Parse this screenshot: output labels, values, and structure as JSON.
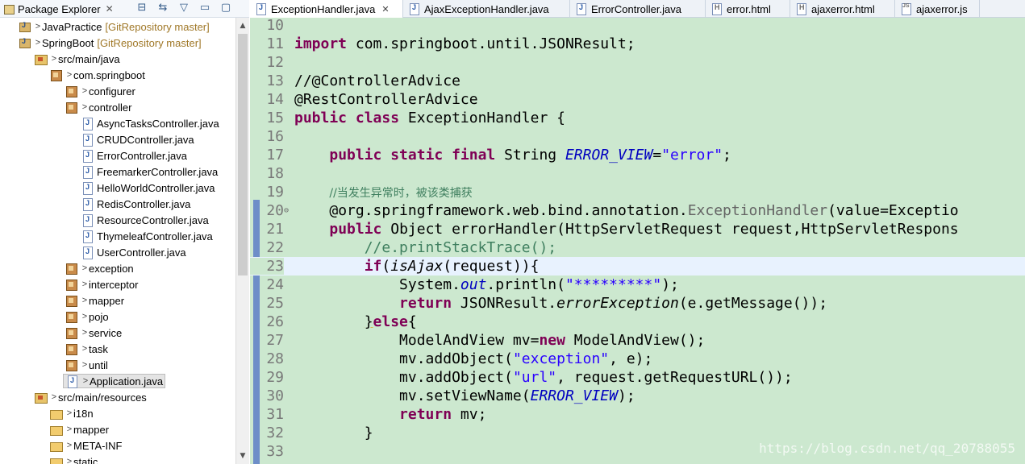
{
  "package_explorer": {
    "title": "Package Explorer",
    "close": "✕",
    "tools": {
      "collapse": "⊟",
      "link": "⇆",
      "menu": "▽",
      "minimize": "▭",
      "maximize": "▢"
    },
    "tree": [
      {
        "name": "JavaPractice",
        "git": "[GitRepository master]"
      },
      {
        "name": "SpringBoot",
        "git": "[GitRepository master]"
      },
      {
        "name": "src/main/java"
      },
      {
        "name": "com.springboot"
      },
      {
        "name": "configurer"
      },
      {
        "name": "controller"
      },
      {
        "name": "AsyncTasksController.java"
      },
      {
        "name": "CRUDController.java"
      },
      {
        "name": "ErrorController.java"
      },
      {
        "name": "FreemarkerController.java"
      },
      {
        "name": "HelloWorldController.java"
      },
      {
        "name": "RedisController.java"
      },
      {
        "name": "ResourceController.java"
      },
      {
        "name": "ThymeleafController.java"
      },
      {
        "name": "UserController.java"
      },
      {
        "name": "exception"
      },
      {
        "name": "interceptor"
      },
      {
        "name": "mapper"
      },
      {
        "name": "pojo"
      },
      {
        "name": "service"
      },
      {
        "name": "task"
      },
      {
        "name": "until"
      },
      {
        "name": "Application.java"
      },
      {
        "name": "src/main/resources"
      },
      {
        "name": "i18n"
      },
      {
        "name": "mapper"
      },
      {
        "name": "META-INF"
      },
      {
        "name": "static"
      }
    ],
    "arrow_collapsed": ">",
    "scroll_up": "▲",
    "scroll_down": "▼"
  },
  "editor": {
    "tabs": [
      {
        "label": "ExceptionHandler.java",
        "close": "✕"
      },
      {
        "label": "AjaxExceptionHandler.java"
      },
      {
        "label": "ErrorController.java"
      },
      {
        "label": "error.html"
      },
      {
        "label": "ajaxerror.html"
      },
      {
        "label": "ajaxerror.js"
      }
    ],
    "line_numbers": [
      "10",
      "11",
      "12",
      "13",
      "14",
      "15",
      "16",
      "17",
      "18",
      "19",
      "20",
      "21",
      "22",
      "23",
      "24",
      "25",
      "26",
      "27",
      "28",
      "29",
      "30",
      "31",
      "32",
      "33"
    ],
    "fold_marker": "⊖",
    "code": {
      "l11_import": "import",
      "l11_rest": " com.springboot.until.JSONResult;",
      "l13": "//@ControllerAdvice",
      "l14": "@RestControllerAdvice",
      "l15_kw": "public class",
      "l15_rest": " ExceptionHandler {",
      "l17_kw": "public static final",
      "l17_type": " String ",
      "l17_field": "ERROR_VIEW",
      "l17_eq": "=",
      "l17_str": "\"error\"",
      "l17_end": ";",
      "l19": "//当发生异常时，被该类捕获",
      "l20_pre": "@org.springframework.web.bind.annotation.",
      "l20_ann": "ExceptionHandler",
      "l20_post": "(value=Exceptio",
      "l21_kw": "public",
      "l21_rest": " Object errorHandler(HttpServletRequest request,HttpServletRespons",
      "l22": "//e.printStackTrace();",
      "l23_kw": "if",
      "l23_paren": "(",
      "l23_method": "isAjax",
      "l23_rest": "(request)){",
      "l24_pre": "System.",
      "l24_out": "out",
      "l24_mid": ".println(",
      "l24_str": "\"*********\"",
      "l24_end": ");",
      "l25_kw": "return",
      "l25_pre": " JSONResult.",
      "l25_method": "errorException",
      "l25_end": "(e.getMessage());",
      "l26_brace": "}",
      "l26_kw": "else",
      "l26_end": "{",
      "l27_pre": "ModelAndView mv=",
      "l27_kw": "new",
      "l27_end": " ModelAndView();",
      "l28_pre": "mv.addObject(",
      "l28_str": "\"exception\"",
      "l28_end": ", e);",
      "l29_pre": "mv.addObject(",
      "l29_str": "\"url\"",
      "l29_end": ", request.getRequestURL());",
      "l30_pre": "mv.setViewName(",
      "l30_field": "ERROR_VIEW",
      "l30_end": ");",
      "l31_kw": "return",
      "l31_end": " mv;",
      "l32": "}"
    },
    "watermark": "https://blog.csdn.net/qq_20788055"
  }
}
